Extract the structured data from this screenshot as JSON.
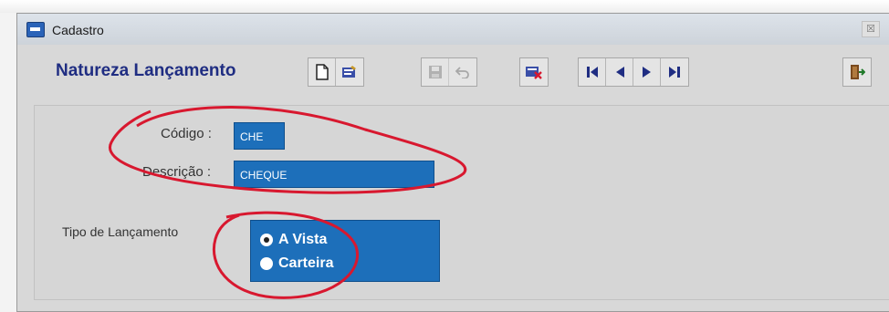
{
  "window": {
    "title": "Cadastro",
    "close_label": "☒"
  },
  "toolbar": {
    "form_heading": "Natureza Lançamento",
    "buttons": [
      {
        "name": "new-record-button",
        "icon": "new-document-icon"
      },
      {
        "name": "edit-record-button",
        "icon": "edit-icon"
      },
      {
        "name": "save-button",
        "icon": "save-icon",
        "disabled": true
      },
      {
        "name": "undo-button",
        "icon": "undo-icon",
        "disabled": true
      },
      {
        "name": "delete-button",
        "icon": "delete-icon"
      },
      {
        "name": "first-record-button",
        "icon": "first-icon"
      },
      {
        "name": "previous-record-button",
        "icon": "previous-icon"
      },
      {
        "name": "next-record-button",
        "icon": "next-icon"
      },
      {
        "name": "last-record-button",
        "icon": "last-icon"
      },
      {
        "name": "exit-button",
        "icon": "exit-door-icon"
      }
    ]
  },
  "form": {
    "codigo_label": "Código :",
    "codigo_value": "CHE",
    "descricao_label": "Descrição :",
    "descricao_value": "CHEQUE",
    "tipo_label": "Tipo de Lançamento",
    "tipo_options": [
      {
        "label": "A Vista",
        "selected": true
      },
      {
        "label": "Carteira",
        "selected": false
      }
    ]
  },
  "colors": {
    "field_bg": "#1d6fba",
    "heading": "#1f2d82",
    "annotation": "#d8182f"
  }
}
